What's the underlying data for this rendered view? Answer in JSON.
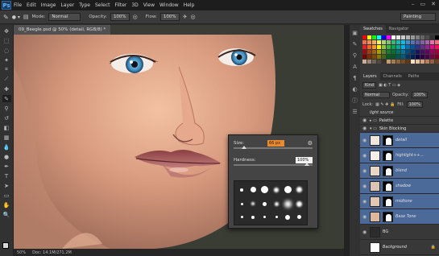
{
  "app": {
    "logo": "Ps"
  },
  "menu": [
    "File",
    "Edit",
    "Image",
    "Layer",
    "Type",
    "Select",
    "Filter",
    "3D",
    "View",
    "Window",
    "Help"
  ],
  "window_controls": [
    "–",
    "▭",
    "✕"
  ],
  "options": {
    "mode_label": "Mode:",
    "mode_value": "Normal",
    "opacity_label": "Opacity:",
    "opacity_value": "100%",
    "flow_label": "Flow:",
    "flow_value": "100%",
    "workspace": "Painting"
  },
  "document": {
    "tab": "09_Beegle.psd @ 50% (detail, RGB/8) *",
    "zoom": "50%",
    "doc_size": "Doc: 14.1M/271.2M"
  },
  "panels": {
    "swatches_tabs": [
      "Swatches",
      "Navigator"
    ],
    "layers_tabs": [
      "Layers",
      "Channels",
      "Paths"
    ],
    "kind": "Kind",
    "blend": "Normal",
    "opacity_label": "Opacity:",
    "opacity": "100%",
    "lock_label": "Lock:",
    "fill_label": "Fill:",
    "fill": "100%",
    "top_layer": "light source",
    "groups": [
      "Palette",
      "Skin Blocking"
    ],
    "layers": [
      {
        "name": "detail",
        "selected": true
      },
      {
        "name": "highlight++...",
        "selected": true
      },
      {
        "name": "blend",
        "selected": true
      },
      {
        "name": "shadow",
        "selected": true
      },
      {
        "name": "midtone",
        "selected": true
      },
      {
        "name": "Base Tone",
        "selected": true
      }
    ],
    "bottom_layers": [
      "BG",
      "Background"
    ]
  },
  "brush_popup": {
    "size_label": "Size:",
    "size_value": "66 px",
    "hardness_label": "Hardness:",
    "hardness_value": "100%"
  },
  "swatch_colors": [
    "#ff0000",
    "#ffff00",
    "#00ff00",
    "#00ffff",
    "#0000ff",
    "#ff00ff",
    "#ffffff",
    "#e6e6e6",
    "#cccccc",
    "#b3b3b3",
    "#999999",
    "#808080",
    "#666666",
    "#4d4d4d",
    "#333333",
    "#000000",
    "#f26c4f",
    "#f68e55",
    "#fbaf5c",
    "#fff467",
    "#acd372",
    "#7cc576",
    "#3bb878",
    "#1abbb4",
    "#00bff3",
    "#438ccb",
    "#5574b9",
    "#605ca8",
    "#855fa8",
    "#a763a8",
    "#f06ea9",
    "#f26d7d",
    "#ed1c24",
    "#f26522",
    "#f7941d",
    "#fff200",
    "#8dc73f",
    "#39b54a",
    "#00a651",
    "#00a99d",
    "#00aeef",
    "#0072bc",
    "#0054a6",
    "#2e3192",
    "#662d91",
    "#92278f",
    "#ec008c",
    "#ed145b",
    "#9e0b0f",
    "#a0410d",
    "#a36209",
    "#aba000",
    "#598527",
    "#1a7b30",
    "#007236",
    "#00746b",
    "#0076a3",
    "#004b80",
    "#003471",
    "#1b1464",
    "#440e62",
    "#630460",
    "#9e005d",
    "#9e0039",
    "#790000",
    "#7b2e00",
    "#7d4900",
    "#827b00",
    "#406618",
    "#005e20",
    "#005826",
    "#005952",
    "#005b7f",
    "#003663",
    "#002157",
    "#0d004c",
    "#32004b",
    "#4b0049",
    "#7b0046",
    "#7a0026",
    "#c7b299",
    "#998675",
    "#736357",
    "#534741",
    "#37302d",
    "#c69c6d",
    "#a67c52",
    "#8c6239",
    "#754c24",
    "#603913",
    "#f5e0c8",
    "#e8c5a2",
    "#d4a37a",
    "#b88058",
    "#96603e",
    "#6b4226"
  ]
}
